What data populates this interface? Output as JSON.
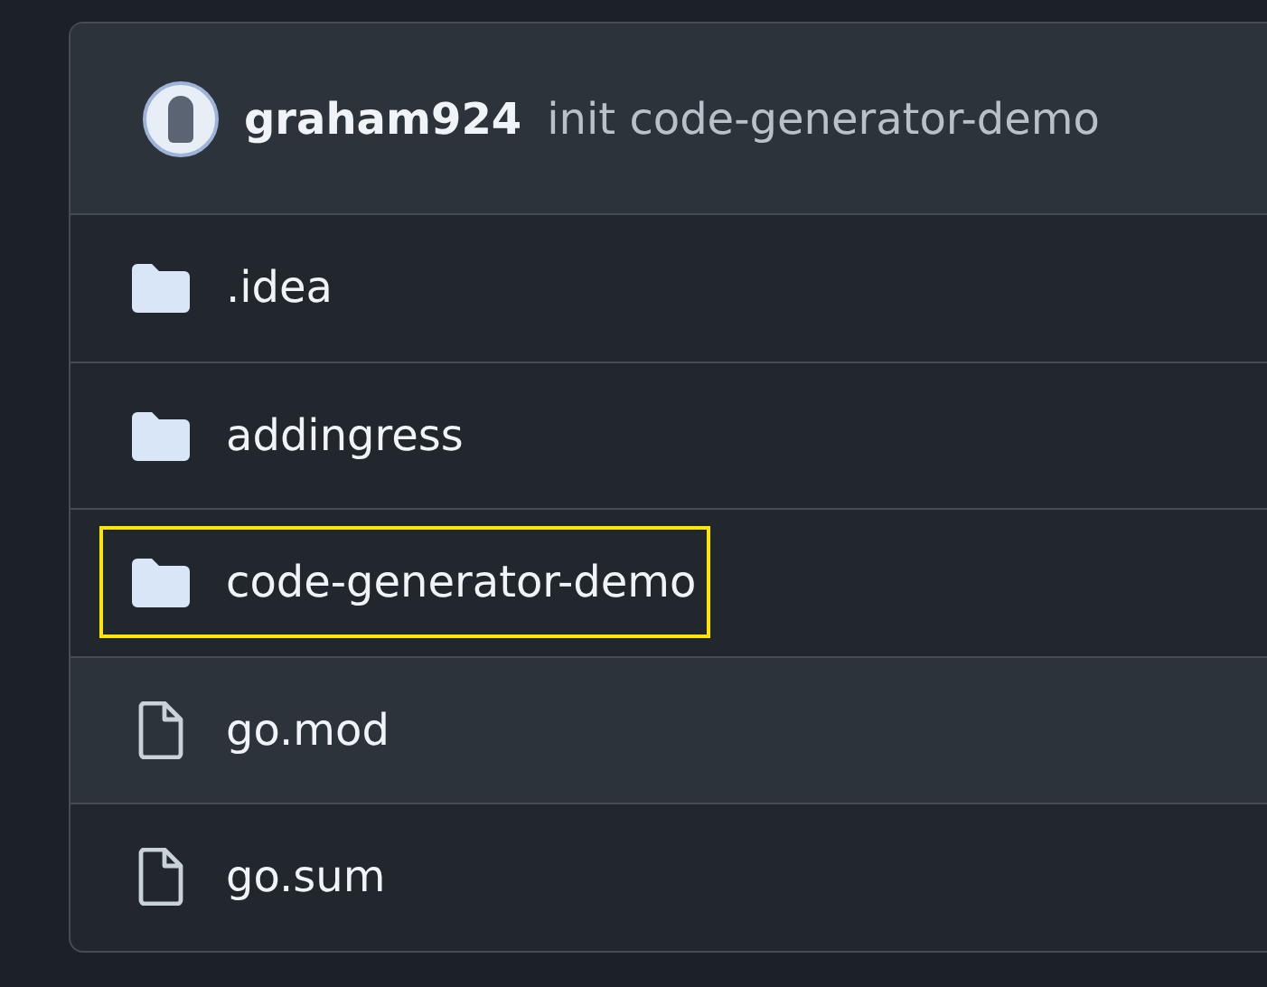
{
  "commit": {
    "author": "graham924",
    "message": "init code-generator-demo"
  },
  "files": [
    {
      "kind": "folder",
      "name": ".idea",
      "highlighted": false,
      "outlined": false
    },
    {
      "kind": "folder",
      "name": "addingress",
      "highlighted": false,
      "outlined": false
    },
    {
      "kind": "folder",
      "name": "code-generator-demo",
      "highlighted": false,
      "outlined": true
    },
    {
      "kind": "file",
      "name": "go.mod",
      "highlighted": true,
      "outlined": false
    },
    {
      "kind": "file",
      "name": "go.sum",
      "highlighted": false,
      "outlined": false
    }
  ]
}
